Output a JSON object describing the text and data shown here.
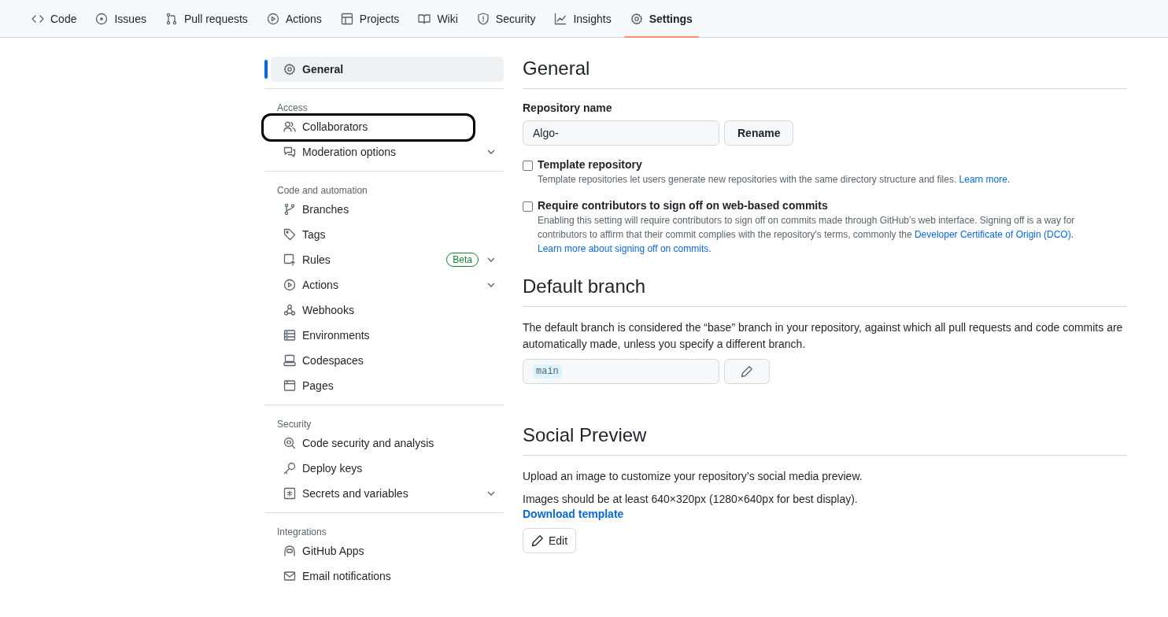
{
  "nav_tabs": [
    {
      "label": "Code",
      "selected": false
    },
    {
      "label": "Issues",
      "selected": false
    },
    {
      "label": "Pull requests",
      "selected": false
    },
    {
      "label": "Actions",
      "selected": false
    },
    {
      "label": "Projects",
      "selected": false
    },
    {
      "label": "Wiki",
      "selected": false
    },
    {
      "label": "Security",
      "selected": false
    },
    {
      "label": "Insights",
      "selected": false
    },
    {
      "label": "Settings",
      "selected": true
    }
  ],
  "sidebar": {
    "sections": [
      {
        "items": [
          {
            "label": "General",
            "selected": true,
            "expandable": false,
            "annotated": false
          }
        ]
      },
      {
        "heading": "Access",
        "items": [
          {
            "label": "Collaborators",
            "selected": false,
            "expandable": false,
            "annotated": true
          },
          {
            "label": "Moderation options",
            "selected": false,
            "expandable": true,
            "annotated": false
          }
        ]
      },
      {
        "heading": "Code and automation",
        "items": [
          {
            "label": "Branches",
            "selected": false,
            "expandable": false,
            "annotated": false
          },
          {
            "label": "Tags",
            "selected": false,
            "expandable": false,
            "annotated": false
          },
          {
            "label": "Rules",
            "selected": false,
            "expandable": true,
            "annotated": false,
            "badge": "Beta"
          },
          {
            "label": "Actions",
            "selected": false,
            "expandable": true,
            "annotated": false
          },
          {
            "label": "Webhooks",
            "selected": false,
            "expandable": false,
            "annotated": false
          },
          {
            "label": "Environments",
            "selected": false,
            "expandable": false,
            "annotated": false
          },
          {
            "label": "Codespaces",
            "selected": false,
            "expandable": false,
            "annotated": false
          },
          {
            "label": "Pages",
            "selected": false,
            "expandable": false,
            "annotated": false
          }
        ]
      },
      {
        "heading": "Security",
        "items": [
          {
            "label": "Code security and analysis",
            "selected": false,
            "expandable": false,
            "annotated": false
          },
          {
            "label": "Deploy keys",
            "selected": false,
            "expandable": false,
            "annotated": false
          },
          {
            "label": "Secrets and variables",
            "selected": false,
            "expandable": true,
            "annotated": false
          }
        ]
      },
      {
        "heading": "Integrations",
        "items": [
          {
            "label": "GitHub Apps",
            "selected": false,
            "expandable": false,
            "annotated": false
          },
          {
            "label": "Email notifications",
            "selected": false,
            "expandable": false,
            "annotated": false
          }
        ]
      }
    ]
  },
  "general": {
    "title": "General",
    "repo_name_label": "Repository name",
    "repo_name": "Algo-",
    "rename_button": "Rename",
    "options": [
      {
        "title": "Template repository",
        "checked": false,
        "description": [
          {
            "text": "Template repositories let users generate new repositories with the same directory structure and files."
          },
          {
            "text": "Learn more.",
            "link": true
          }
        ]
      },
      {
        "title": "Require contributors to sign off on web-based commits",
        "checked": false,
        "description": [
          {
            "text": "Enabling this setting will require contributors to sign off on commits made through GitHub’s web interface. Signing off is a way for contributors to affirm that their commit complies with the repository's terms, commonly the"
          },
          {
            "text": "Developer Certificate of Origin (DCO).",
            "link": true
          },
          {
            "text": "Learn more about signing off on commits.",
            "link": true
          }
        ]
      }
    ]
  },
  "default_branch": {
    "title": "Default branch",
    "description": "The default branch is considered the “base” branch in your repository, against which all pull requests and code commits are automatically made, unless you specify a different branch.",
    "branch": "main"
  },
  "social_preview": {
    "title": "Social Preview",
    "text": "Upload an image to customize your repository’s social media preview.",
    "requirements": "Images should be at least 640×320px (1280×640px for best display).",
    "download_link": "Download template",
    "edit_button": "Edit"
  }
}
